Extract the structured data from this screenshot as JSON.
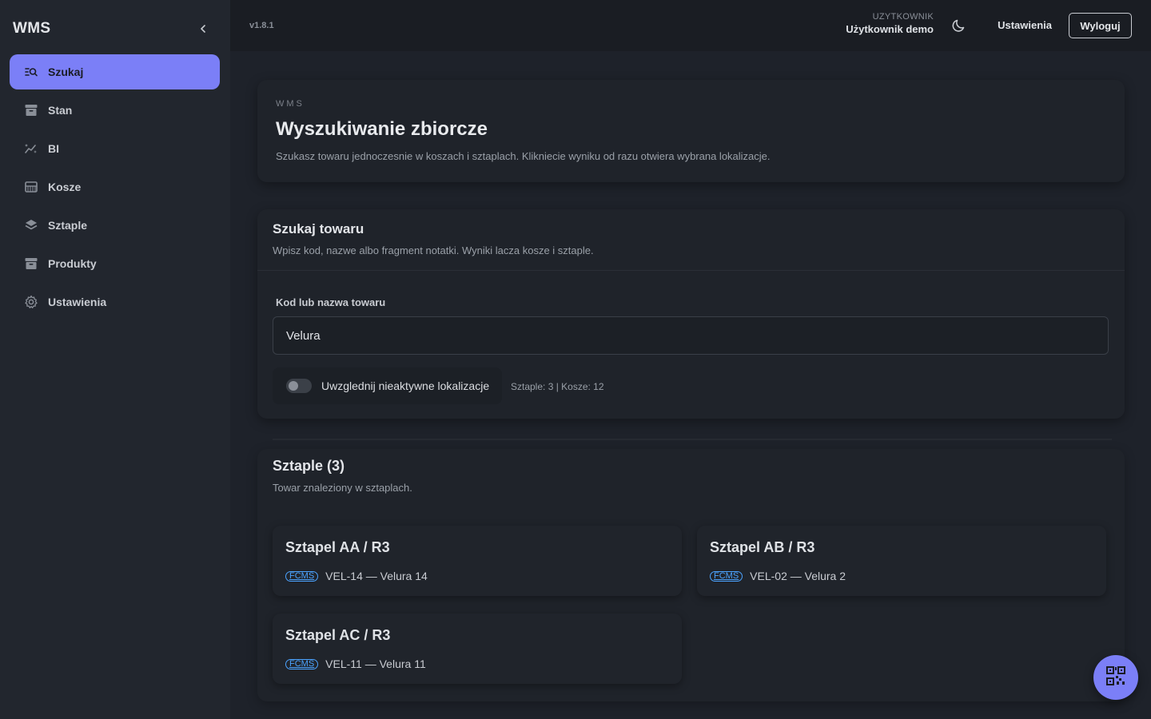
{
  "sidebar": {
    "brand": "WMS",
    "items": [
      {
        "label": "Szukaj",
        "icon": "search-list-icon",
        "active": true
      },
      {
        "label": "Stan",
        "icon": "archive-icon"
      },
      {
        "label": "BI",
        "icon": "chart-sparkle-icon"
      },
      {
        "label": "Kosze",
        "icon": "basket-icon"
      },
      {
        "label": "Sztaple",
        "icon": "layers-icon"
      },
      {
        "label": "Produkty",
        "icon": "archive-icon"
      },
      {
        "label": "Ustawienia",
        "icon": "gear-icon"
      }
    ]
  },
  "topbar": {
    "version": "v1.8.1",
    "user_label": "UZYTKOWNIK",
    "user_name": "Użytkownik demo",
    "settings_label": "Ustawienia",
    "logout_label": "Wyloguj"
  },
  "hero": {
    "eyebrow": "WMS",
    "title": "Wyszukiwanie zbiorcze",
    "description": "Szukasz towaru jednoczesnie w koszach i sztaplach. Klikniecie wyniku od razu otwiera wybrana lokalizacje."
  },
  "search": {
    "title": "Szukaj towaru",
    "description": "Wpisz kod, nazwe albo fragment notatki. Wyniki lacza kosze i sztaple.",
    "field_label": "Kod lub nazwa towaru",
    "value": "Velura",
    "toggle_label": "Uwzglednij nieaktywne lokalizacje",
    "toggle_on": false,
    "counts": "Sztaple: 3 | Kosze: 12"
  },
  "results": {
    "title": "Sztaple (3)",
    "description": "Towar znaleziony w sztaplach.",
    "items": [
      {
        "title": "Sztapel AA / R3",
        "badge": "FCMS",
        "line": "VEL-14 — Velura 14"
      },
      {
        "title": "Sztapel AB / R3",
        "badge": "FCMS",
        "line": "VEL-02 — Velura 2"
      },
      {
        "title": "Sztapel AC / R3",
        "badge": "FCMS",
        "line": "VEL-11 — Velura 11"
      }
    ]
  },
  "colors": {
    "accent": "#7b7ff7",
    "badge": "#4ba3ff",
    "background": "#1e222a",
    "sidebar": "#22262e"
  }
}
